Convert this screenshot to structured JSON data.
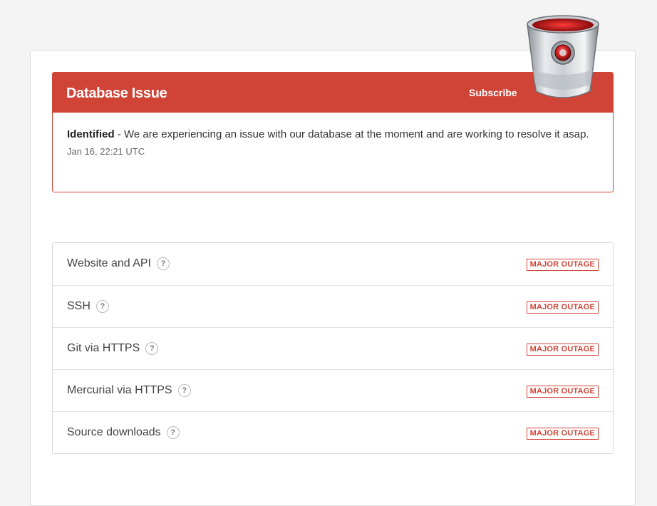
{
  "incident": {
    "title": "Database Issue",
    "subscribe_label": "Subscribe",
    "status_label": "Identified",
    "message": " - We are experiencing an issue with our database at the moment and are working to resolve it asap.",
    "timestamp": "Jan 16, 22:21 UTC",
    "header_color": "#d04437"
  },
  "logo": {
    "icon": "bucket-logo-icon"
  },
  "components": [
    {
      "name": "Website and API",
      "help": "?",
      "status": "MAJOR OUTAGE"
    },
    {
      "name": "SSH",
      "help": "?",
      "status": "MAJOR OUTAGE"
    },
    {
      "name": "Git via HTTPS",
      "help": "?",
      "status": "MAJOR OUTAGE"
    },
    {
      "name": "Mercurial via HTTPS",
      "help": "?",
      "status": "MAJOR OUTAGE"
    },
    {
      "name": "Source downloads",
      "help": "?",
      "status": "MAJOR OUTAGE"
    }
  ],
  "colors": {
    "outage": "#d04437",
    "background": "#f4f4f4"
  }
}
